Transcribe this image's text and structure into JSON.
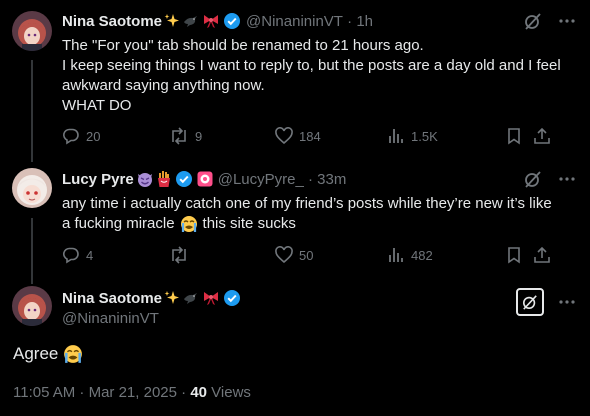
{
  "posts": [
    {
      "name": "Nina Saotome",
      "handle": "@NinanininVT",
      "time": "1h",
      "lines": [
        "The \"For you\" tab should be renamed to 21 hours ago.",
        "I keep seeing things I want to reply to, but the posts are a day old and I feel",
        "awkward saying anything now.",
        "WHAT DO"
      ],
      "stats": {
        "replies": "20",
        "reposts": "9",
        "likes": "184",
        "views": "1.5K"
      }
    },
    {
      "name": "Lucy Pyre",
      "handle": "@LucyPyre_",
      "time": "33m",
      "line1": "any time i actually catch one of my friend’s posts while they’re new it’s like",
      "line2_before": "a fucking miracle",
      "line2_after": "this site sucks",
      "stats": {
        "replies": "4",
        "reposts": "",
        "likes": "50",
        "views": "482"
      }
    }
  ],
  "main_post": {
    "name": "Nina Saotome",
    "handle": "@NinanininVT",
    "text": "Agree",
    "timestamp": "11:05 AM · Mar 21, 2025 · ",
    "views_count": "40",
    "views_label": " Views"
  },
  "colors": {
    "background": "#000000",
    "text": "#e7e9ea",
    "muted": "#71767b",
    "verified": "#1d9bf0"
  },
  "icons": [
    "grok-icon",
    "more-icon",
    "reply-icon",
    "repost-icon",
    "like-icon",
    "views-icon",
    "bookmark-icon",
    "share-icon",
    "verified-badge-icon",
    "sparkles-icon",
    "bird-icon",
    "ribbon-icon",
    "devil-icon",
    "fries-icon",
    "crying-emoji-icon"
  ]
}
